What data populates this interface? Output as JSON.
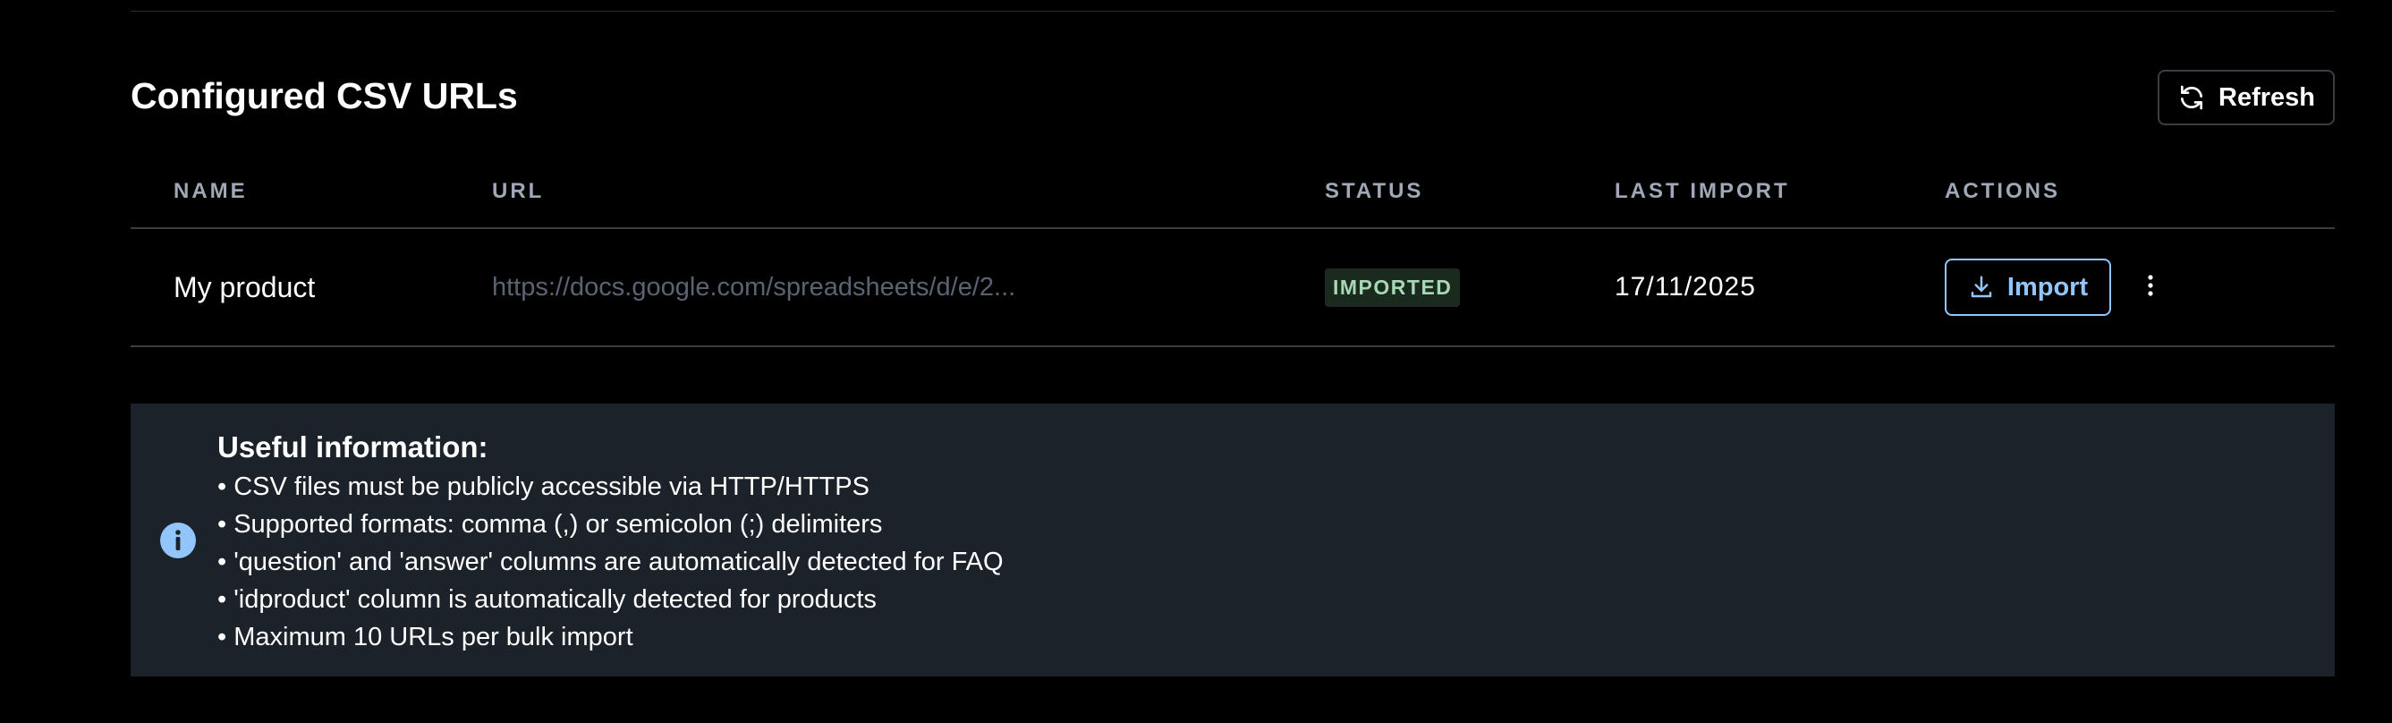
{
  "section": {
    "title": "Configured CSV URLs",
    "refresh_label": "Refresh"
  },
  "table": {
    "headers": {
      "name": "NAME",
      "url": "URL",
      "status": "STATUS",
      "last_import": "LAST IMPORT",
      "actions": "ACTIONS"
    },
    "rows": [
      {
        "name": "My product",
        "url": "https://docs.google.com/spreadsheets/d/e/2...",
        "status": "IMPORTED",
        "last_import": "17/11/2025",
        "import_label": "Import"
      }
    ]
  },
  "info": {
    "title": "Useful information:",
    "lines": [
      "• CSV files must be publicly accessible via HTTP/HTTPS",
      "• Supported formats: comma (,) or semicolon (;) delimiters",
      "• 'question' and 'answer' columns are automatically detected for FAQ",
      "• 'idproduct' column is automatically detected for products",
      "• Maximum 10 URLs per bulk import"
    ]
  },
  "colors": {
    "background": "#000000",
    "info_background": "#1c2229",
    "accent": "#93c5fd",
    "status_badge_bg": "#1a2a1f",
    "status_badge_text": "#a7d8b4"
  },
  "icons": {
    "refresh": "refresh-icon",
    "import": "download-icon",
    "more": "kebab-menu-icon",
    "info": "info-icon"
  }
}
